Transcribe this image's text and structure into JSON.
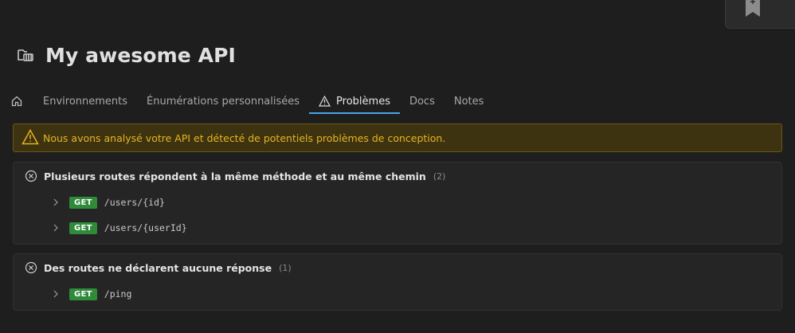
{
  "header": {
    "title": "My awesome API",
    "icon": "api-folder-icon"
  },
  "tabs": [
    {
      "label": "",
      "icon": "home-icon"
    },
    {
      "label": "Environnements"
    },
    {
      "label": "Énumérations personnalisées"
    },
    {
      "label": "Problèmes",
      "icon": "warning-icon",
      "active": true
    },
    {
      "label": "Docs"
    },
    {
      "label": "Notes"
    }
  ],
  "banner": {
    "text": "Nous avons analysé votre API et détecté de potentiels problèmes de conception.",
    "color": "#e6b422"
  },
  "problems": [
    {
      "title": "Plusieurs routes répondent à la même méthode et au même chemin",
      "count": "(2)",
      "routes": [
        {
          "method": "GET",
          "path": "/users/{id}"
        },
        {
          "method": "GET",
          "path": "/users/{userId}"
        }
      ]
    },
    {
      "title": "Des routes ne déclarent aucune réponse",
      "count": "(1)",
      "routes": [
        {
          "method": "GET",
          "path": "/ping"
        }
      ]
    }
  ],
  "colors": {
    "accent": "#4aa3e8",
    "get_method": "#2f8a3a",
    "warning": "#e6b422"
  }
}
